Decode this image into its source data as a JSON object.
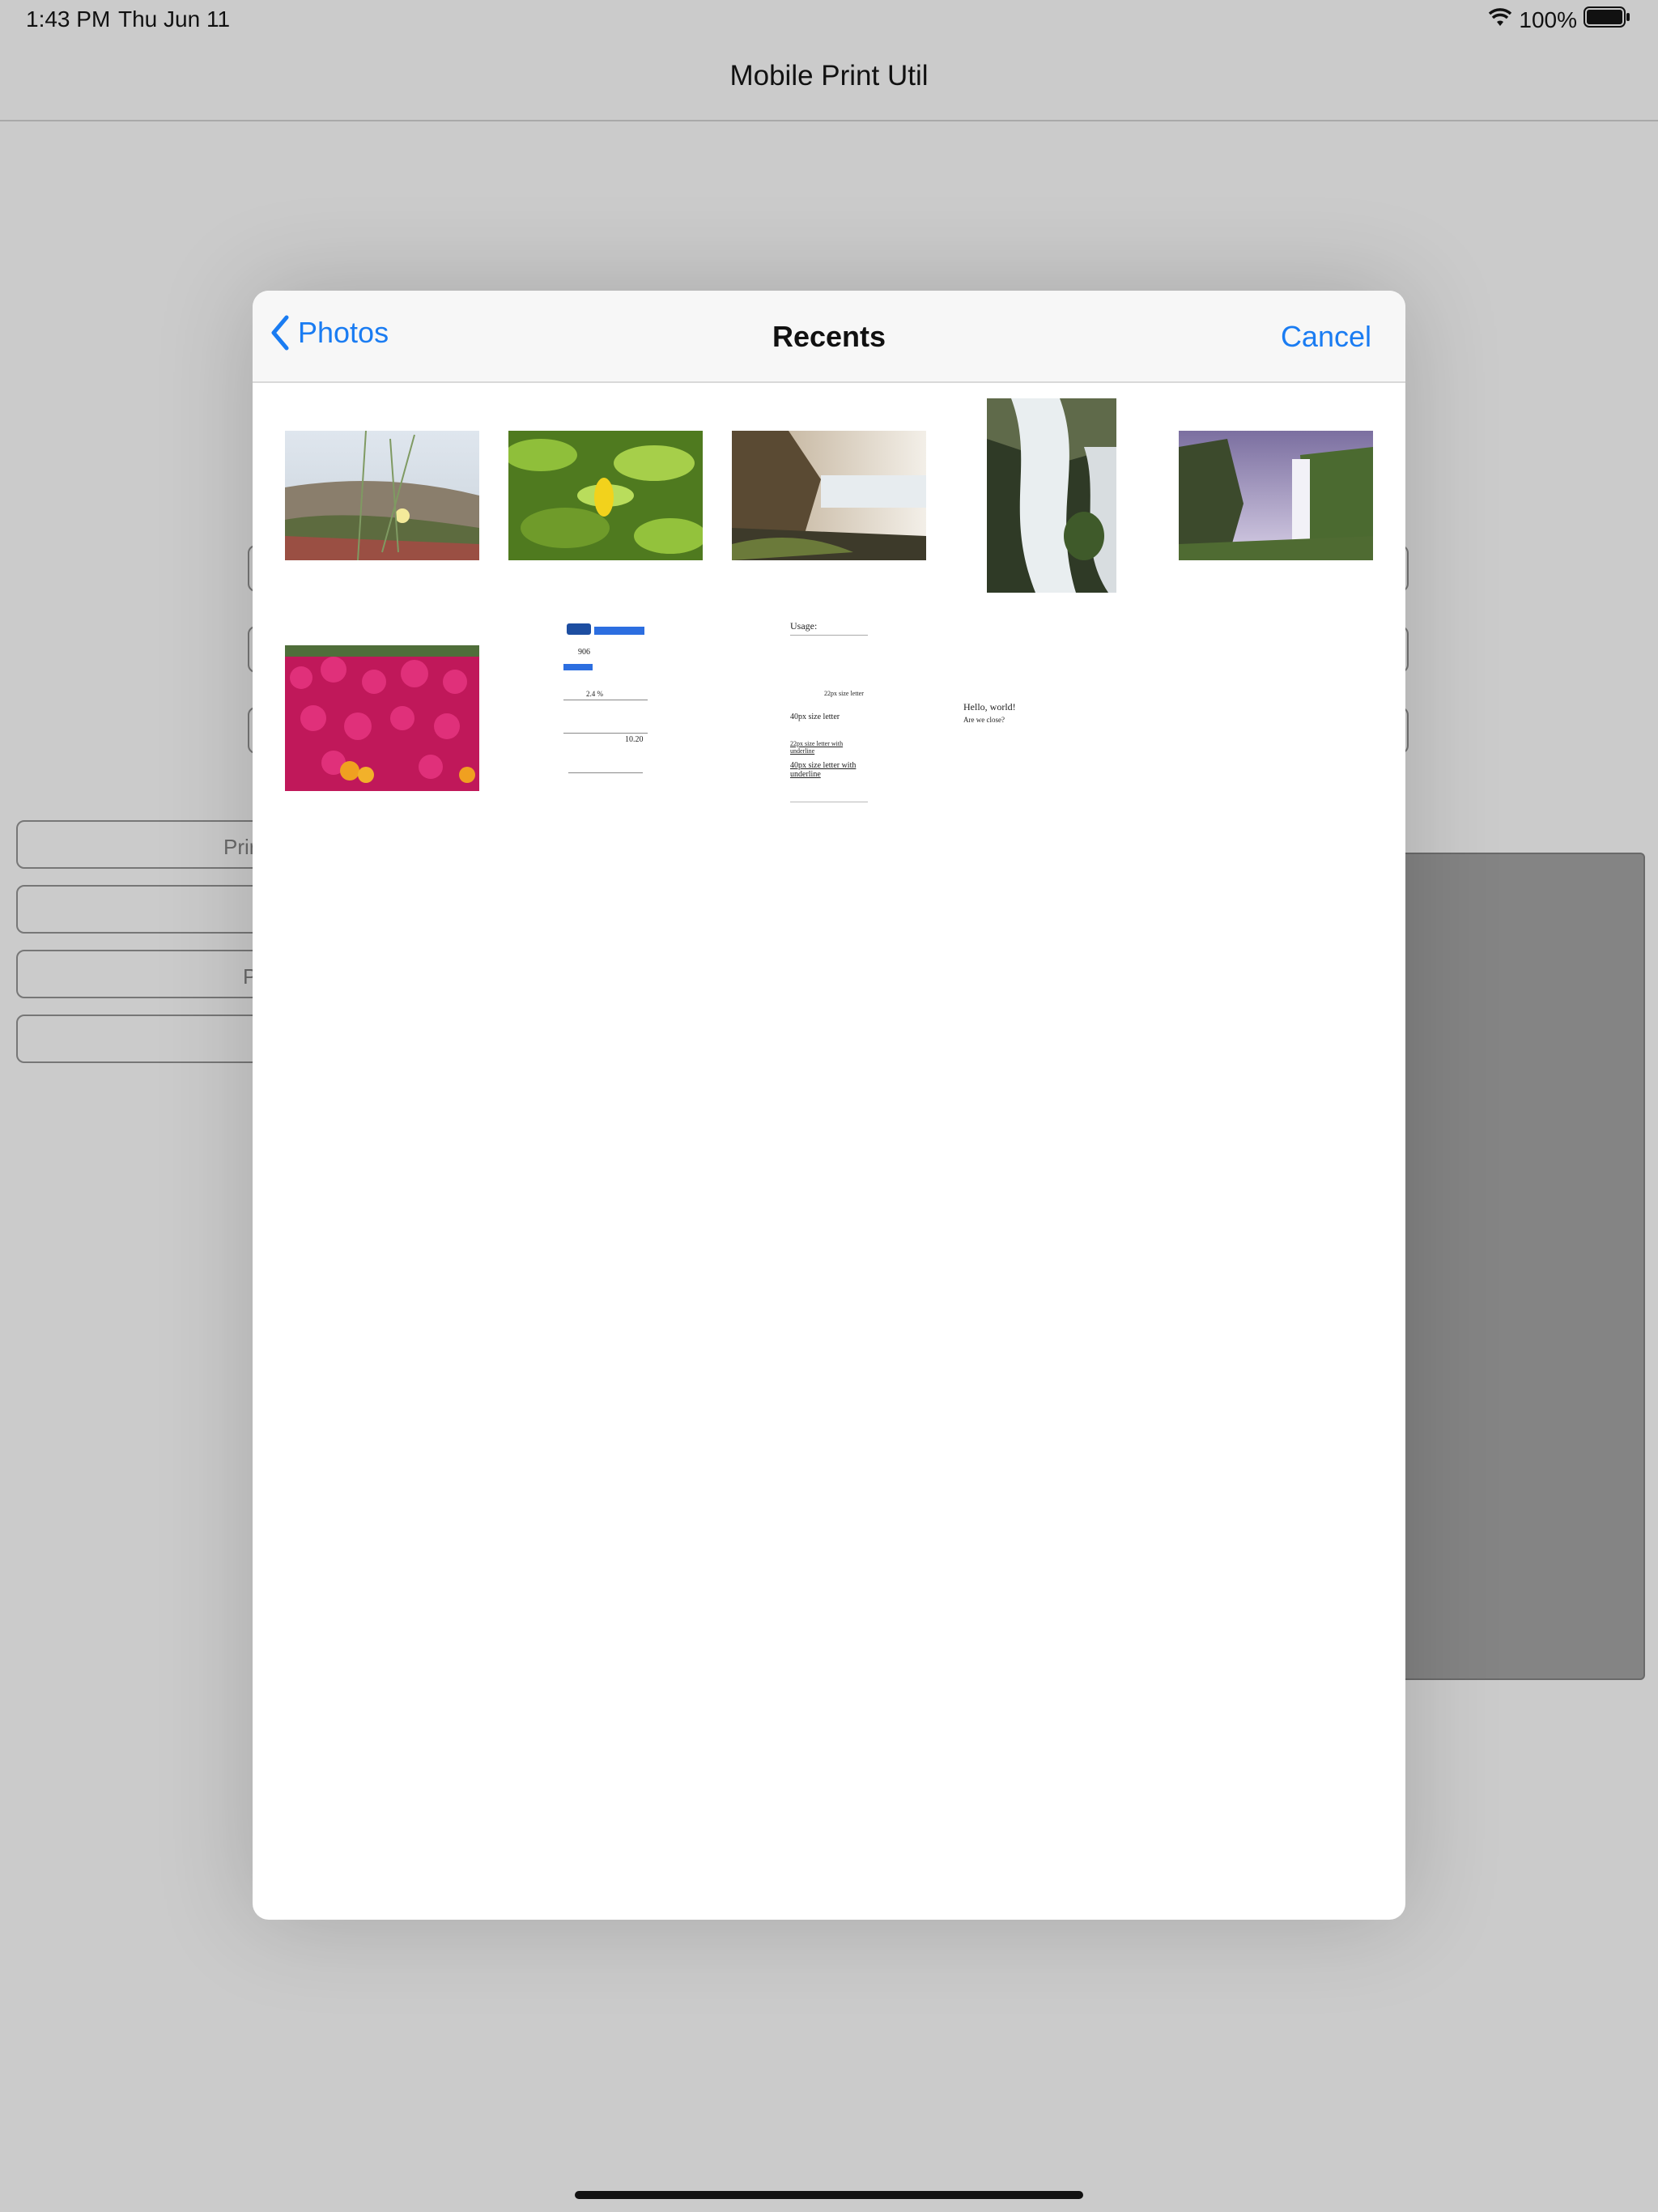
{
  "status_bar": {
    "time": "1:43 PM",
    "date": "Thu Jun 11",
    "battery": "100%"
  },
  "app": {
    "title": "Mobile Print Util"
  },
  "background_buttons": {
    "print_label_fragment": "Prir",
    "p_label_fragment": "P"
  },
  "picker": {
    "back_label": "Photos",
    "title": "Recents",
    "cancel_label": "Cancel",
    "documents": {
      "receipt_number": "906",
      "receipt_rate": "2.4 %",
      "receipt_total": "10.20",
      "usage_heading": "Usage:",
      "usage_lines": [
        "22px size letter",
        "40px size letter",
        "22px size letter with underline",
        "40px size letter with underline"
      ],
      "hello_line1": "Hello, world!",
      "hello_line2": "Are we close?"
    }
  },
  "colors": {
    "accent": "#1a7cf2",
    "dimmed_background": "#cbcbcb",
    "preview_panel": "#848484"
  }
}
